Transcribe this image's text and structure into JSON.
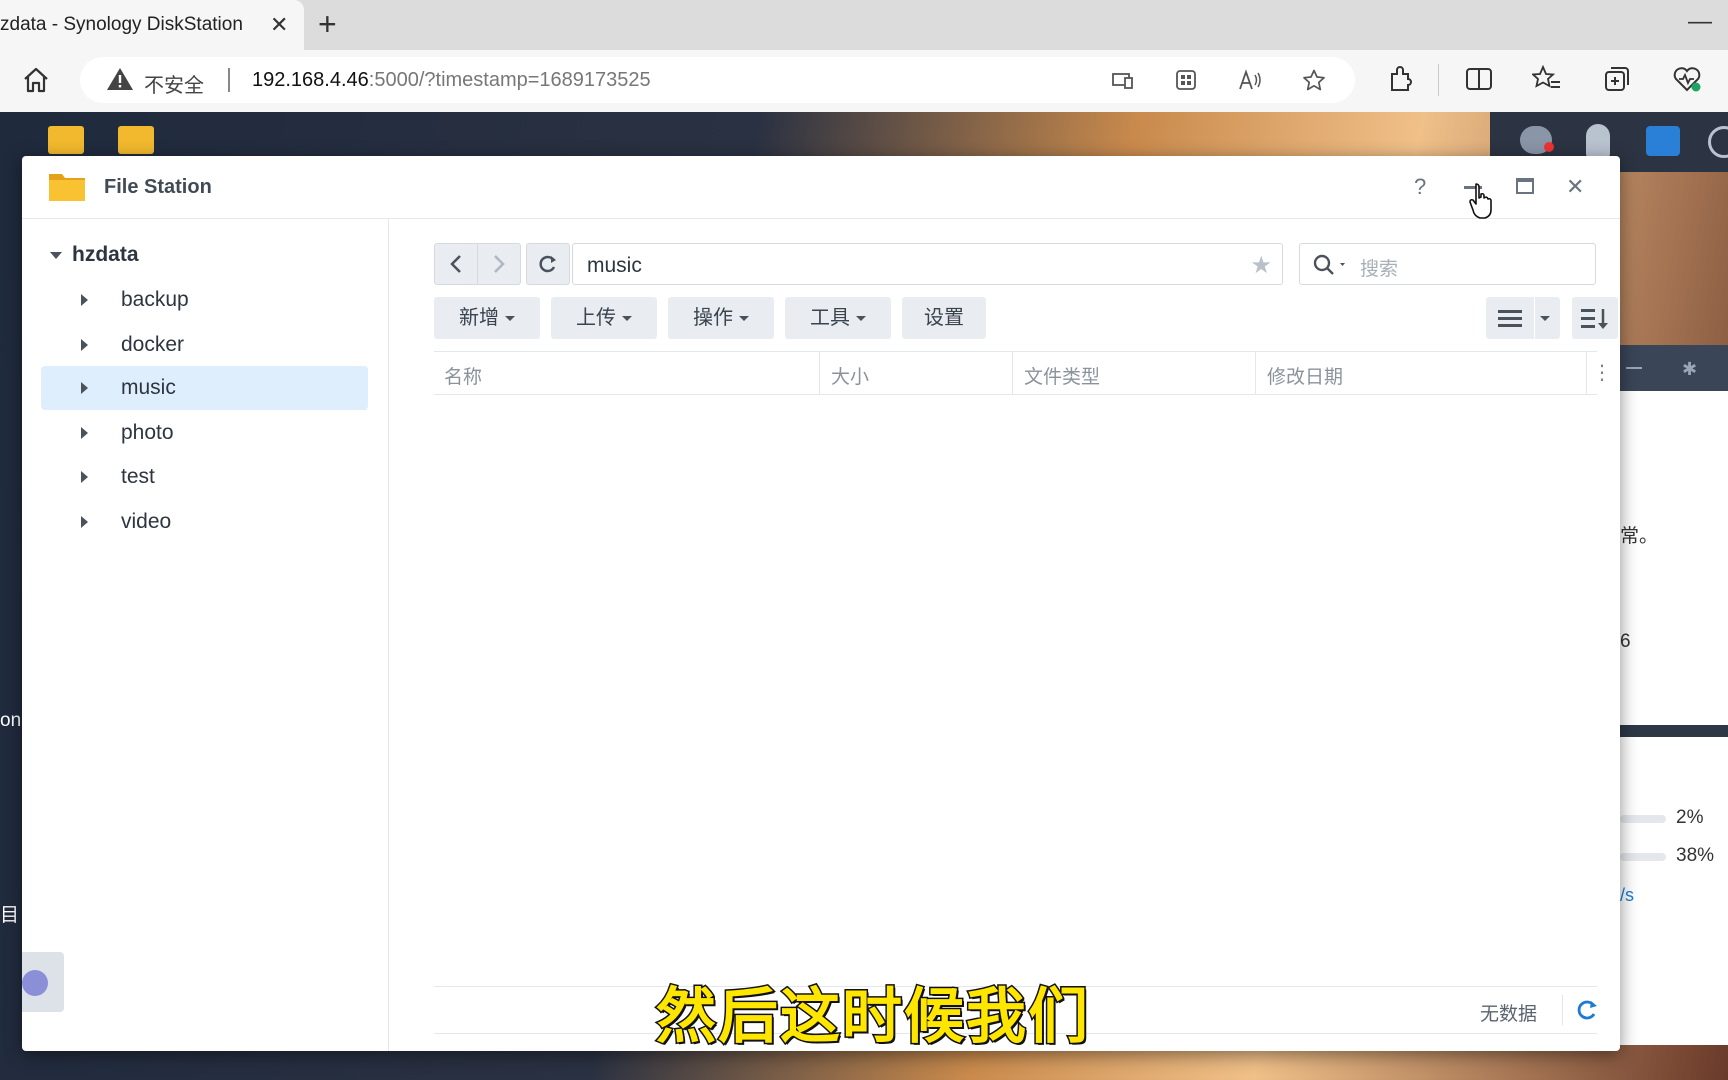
{
  "browser": {
    "tab_title": "zdata - Synology DiskStation",
    "insecure_label": "不安全",
    "url_host": "192.168.4.46",
    "url_rest": ":5000/?timestamp=1689173525"
  },
  "window": {
    "title": "File Station",
    "help_label": "?"
  },
  "tree": {
    "root": "hzdata",
    "items": [
      {
        "label": "backup"
      },
      {
        "label": "docker"
      },
      {
        "label": "music"
      },
      {
        "label": "photo"
      },
      {
        "label": "test"
      },
      {
        "label": "video"
      }
    ],
    "selected": "music"
  },
  "toolbar": {
    "path": "music",
    "search_placeholder": "搜索",
    "buttons": [
      "新增",
      "上传",
      "操作",
      "工具",
      "设置"
    ]
  },
  "columns": [
    "名称",
    "大小",
    "文件类型",
    "修改日期"
  ],
  "status": {
    "empty_text": "无数据"
  },
  "background_widget": {
    "text1": "常。",
    "text2": "6",
    "pct1": "2%",
    "pct2": "38%",
    "rate": "/s",
    "left_fragment": "on",
    "left_fragment2": "目"
  },
  "subtitle": "然后这时候我们",
  "colors": {
    "selection": "#dfeefc",
    "accent": "#1c7cd5",
    "subtitle": "#ffe600"
  }
}
